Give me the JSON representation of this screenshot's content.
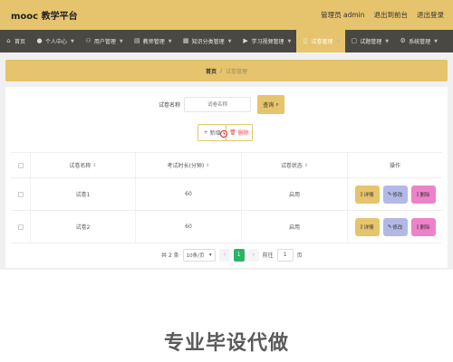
{
  "header": {
    "title": "mooc 教学平台",
    "admin_label": "管理员 admin",
    "to_frontend": "退出到前台",
    "logout": "退出登录"
  },
  "nav": [
    {
      "label": "首页",
      "icon": "home-icon",
      "glyph": "⌂",
      "has_chevron": false
    },
    {
      "label": "个人中心",
      "icon": "user-icon",
      "glyph": "👤",
      "has_chevron": true
    },
    {
      "label": "用户管理",
      "icon": "users-icon",
      "glyph": "⚇",
      "has_chevron": true
    },
    {
      "label": "教师管理",
      "icon": "teacher-icon",
      "glyph": "▤",
      "has_chevron": true
    },
    {
      "label": "知识分类管理",
      "icon": "category-icon",
      "glyph": "▦",
      "has_chevron": true
    },
    {
      "label": "学习视频管理",
      "icon": "video-icon",
      "glyph": "▶",
      "has_chevron": true
    },
    {
      "label": "试卷管理",
      "icon": "paper-icon",
      "glyph": "▯",
      "has_chevron": true,
      "active": true
    },
    {
      "label": "试题管理",
      "icon": "question-icon",
      "glyph": "▢",
      "has_chevron": true
    },
    {
      "label": "系统管理",
      "icon": "settings-icon",
      "glyph": "⚙",
      "has_chevron": true
    }
  ],
  "breadcrumb": {
    "home": "首页",
    "separator": "/",
    "current": "试卷管理"
  },
  "search": {
    "label": "试卷名称",
    "placeholder": "试卷名称",
    "button": "查询"
  },
  "actions": {
    "add": "新增",
    "delete": "删除"
  },
  "table": {
    "headers": [
      "试卷名称",
      "考试时长(分钟)",
      "试卷状态",
      "操作"
    ],
    "rows": [
      {
        "name": "试卷1",
        "duration": "60",
        "status": "启用"
      },
      {
        "name": "试卷2",
        "duration": "60",
        "status": "启用"
      }
    ],
    "row_buttons": {
      "detail": "详情",
      "edit": "修改",
      "delete": "删除"
    }
  },
  "pagination": {
    "total": "共 2 条",
    "page_size": "10条/页",
    "prev": "‹",
    "current_page": "1",
    "next": "›",
    "goto_label": "前往",
    "goto_value": "1",
    "page_suffix": "页"
  },
  "watermark": "专业毕设代做",
  "colors": {
    "accent": "#e6c46d",
    "nav_bg": "#4a4842",
    "detail": "#e6c46d",
    "edit": "#b3b9e6",
    "delete": "#ee82c9",
    "page_active": "#2bb36b"
  }
}
